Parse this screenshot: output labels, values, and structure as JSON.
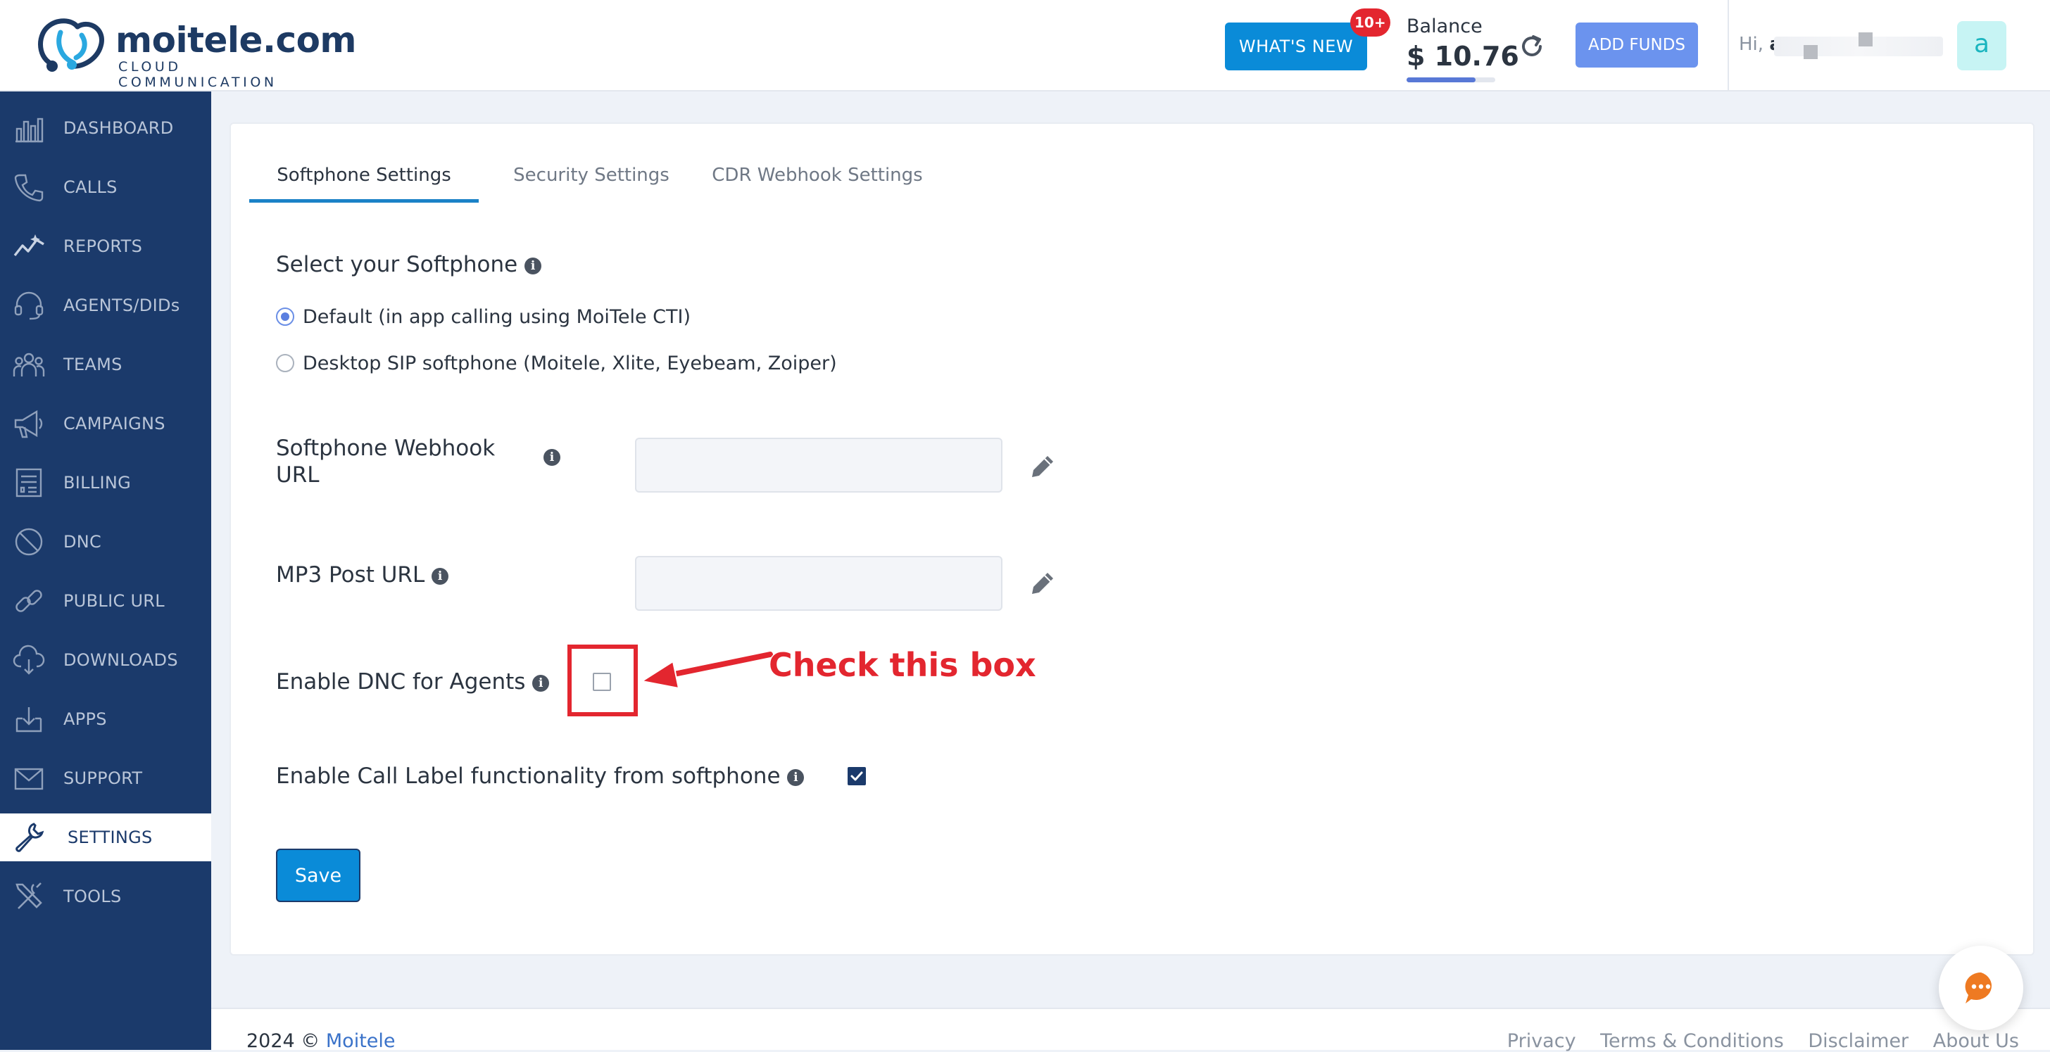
{
  "brand": {
    "name": "moitele.com",
    "tagline": "CLOUD COMMUNICATION"
  },
  "header": {
    "whats_new_label": "WHAT'S NEW",
    "whats_new_badge": "10+",
    "balance_label": "Balance",
    "balance_amount": "$ 10.76",
    "add_funds_label": "ADD FUNDS",
    "greeting_prefix": "Hi,",
    "greeting_name": "a",
    "avatar_letter": "a"
  },
  "sidebar": {
    "items": [
      {
        "label": "DASHBOARD",
        "icon": "dashboard-icon"
      },
      {
        "label": "CALLS",
        "icon": "phone-icon"
      },
      {
        "label": "REPORTS",
        "icon": "reports-icon"
      },
      {
        "label": "AGENTS/DIDs",
        "icon": "headset-icon"
      },
      {
        "label": "TEAMS",
        "icon": "team-icon"
      },
      {
        "label": "CAMPAIGNS",
        "icon": "megaphone-icon"
      },
      {
        "label": "BILLING",
        "icon": "invoice-icon"
      },
      {
        "label": "DNC",
        "icon": "block-icon"
      },
      {
        "label": "PUBLIC URL",
        "icon": "link-icon"
      },
      {
        "label": "DOWNLOADS",
        "icon": "cloud-download-icon"
      },
      {
        "label": "APPS",
        "icon": "download-tray-icon"
      },
      {
        "label": "SUPPORT",
        "icon": "mail-icon"
      },
      {
        "label": "SETTINGS",
        "icon": "wrench-icon",
        "active": true
      },
      {
        "label": "TOOLS",
        "icon": "tools-icon"
      }
    ]
  },
  "tabs": [
    {
      "label": "Softphone Settings",
      "active": true
    },
    {
      "label": "Security Settings",
      "active": false
    },
    {
      "label": "CDR Webhook Settings",
      "active": false
    }
  ],
  "softphone": {
    "title": "Select your Softphone",
    "options": [
      {
        "label": "Default (in app calling using MoiTele CTI)",
        "selected": true
      },
      {
        "label": "Desktop SIP softphone (Moitele, Xlite, Eyebeam, Zoiper)",
        "selected": false
      }
    ]
  },
  "fields": {
    "webhook_label_line1": "Softphone Webhook",
    "webhook_label_line2": "URL",
    "webhook_value": "",
    "mp3_label": "MP3 Post URL",
    "mp3_value": "",
    "dnc_label": "Enable DNC for Agents",
    "dnc_checked": false,
    "call_label_label": "Enable Call Label functionality from softphone",
    "call_label_checked": true
  },
  "annotation": {
    "text": "Check this box",
    "color": "#e3262f"
  },
  "save_label": "Save",
  "footer": {
    "copyright": "2024 ©",
    "brand_link": "Moitele",
    "links": [
      "Privacy",
      "Terms & Conditions",
      "Disclaimer",
      "About Us"
    ]
  },
  "colors": {
    "sidebar": "#1b3a6b",
    "primary": "#0a8bd8",
    "accent": "#6b93ee",
    "alert": "#e3262f"
  }
}
